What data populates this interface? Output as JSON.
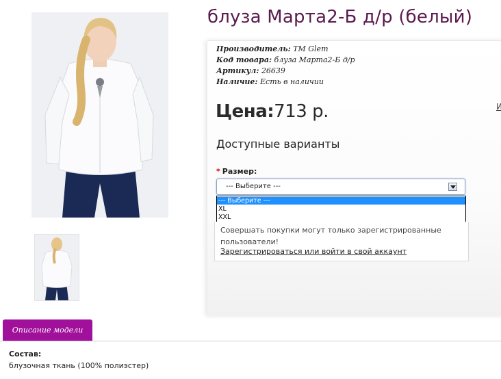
{
  "product": {
    "title": "блуза Марта2-Б д/р (белый)",
    "meta": [
      {
        "label": "Производитель:",
        "value": "ТМ Glem"
      },
      {
        "label": "Код товара:",
        "value": "блуза Марта2-Б д/р"
      },
      {
        "label": "Артикул:",
        "value": "26639"
      },
      {
        "label": "Наличие:",
        "value": "Есть в наличии"
      }
    ],
    "price_label": "Цена:",
    "price_value": "713 р.",
    "edge_link": "И"
  },
  "options": {
    "heading": "Доступные варианты",
    "required_mark": "*",
    "size_label": "Размер:",
    "selected": "--- Выберите ---",
    "list": [
      "--- Выберите ---",
      "XL",
      "XXL"
    ]
  },
  "notice": {
    "text": "Совершать покупки могут только зарегистрированные пользователи!",
    "link": "Зарегистрироваться или войти в свой аккаунт"
  },
  "tabs": {
    "description": "Описание модели"
  },
  "description": {
    "heading": "Состав:",
    "text": "блузочная ткань (100% полиэстер)"
  },
  "colors": {
    "title": "#5b1a4e",
    "tab": "#a0109a",
    "highlight": "#1e90ff",
    "required": "#e00000"
  }
}
